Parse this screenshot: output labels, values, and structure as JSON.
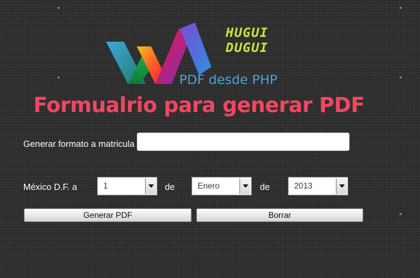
{
  "header": {
    "brand_lines": [
      "HUGUI",
      "DUGUI"
    ],
    "subtitle": "PDF desde PHP"
  },
  "title": "Formualrio para generar PDF",
  "form": {
    "matricula_label": "Generar formato a matricula",
    "matricula_value": "",
    "location_label": "México D.F. a",
    "de_label_1": "de",
    "de_label_2": "de",
    "day": "1",
    "month": "Enero",
    "year": "2013",
    "generate_button": "Generar PDF",
    "clear_button": "Borrar"
  },
  "colors": {
    "title": "#f24763",
    "subtitle": "#4aa3df",
    "brand": "#c8e63a",
    "background": "#2b2b2b"
  },
  "icons": {
    "logo": "wm-logo-icon",
    "dropdown": "chevron-down-icon"
  }
}
